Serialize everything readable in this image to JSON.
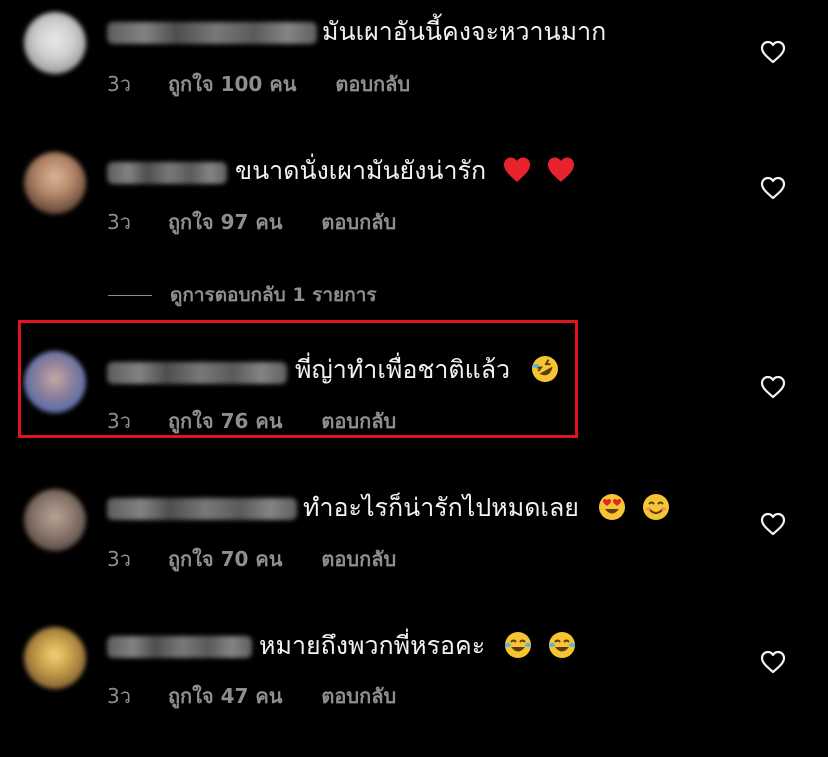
{
  "comments": [
    {
      "text": "มันเผาอันนี้คงจะหวานมาก",
      "time": "3ว",
      "likes": "ถูกใจ 100 คน",
      "reply": "ตอบกลับ",
      "emojis": []
    },
    {
      "text": "ขนาดนั่งเผามันยังน่ารัก",
      "time": "3ว",
      "likes": "ถูกใจ 97 คน",
      "reply": "ตอบกลับ",
      "emojis": [
        "red-heart",
        "red-heart"
      ]
    },
    {
      "text": "พี่ญ่าทำเพื่อชาติแล้ว",
      "time": "3ว",
      "likes": "ถูกใจ 76 คน",
      "reply": "ตอบกลับ",
      "emojis": [
        "rolling-laughing"
      ]
    },
    {
      "text": "ทำอะไรก็น่ารักไปหมดเลย",
      "time": "3ว",
      "likes": "ถูกใจ 70 คน",
      "reply": "ตอบกลับ",
      "emojis": [
        "heart-eyes",
        "smiling-face"
      ]
    },
    {
      "text": "หมายถึงพวกพี่หรอคะ",
      "time": "3ว",
      "likes": "ถูกใจ 47 คน",
      "reply": "ตอบกลับ",
      "emojis": [
        "tears-of-joy",
        "tears-of-joy"
      ]
    }
  ],
  "view_replies": "ดูการตอบกลับ 1 รายการ",
  "colors": {
    "background": "#000000",
    "text": "#f2f2f2",
    "meta": "#8e8e8e",
    "highlight": "#e0141e"
  },
  "icons": {
    "like": "heart-outline-icon"
  }
}
